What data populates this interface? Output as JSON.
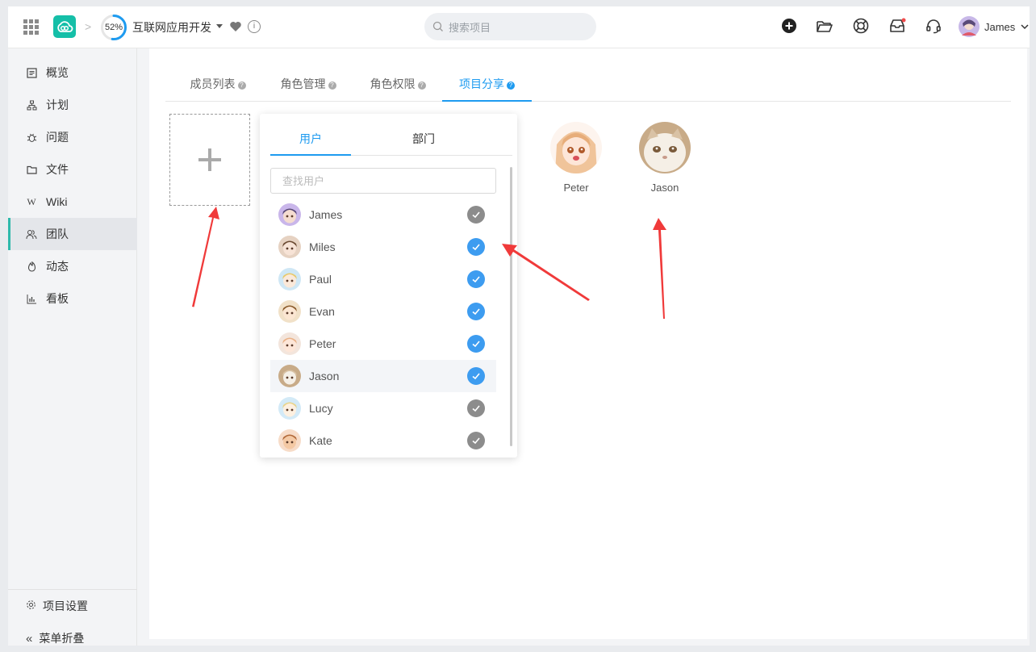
{
  "header": {
    "progress": "52%",
    "progress_value": 0.52,
    "project_name": "互联网应用开发",
    "search_placeholder": "搜索项目",
    "user_name": "James",
    "accent": "#1e9bf0",
    "brand": "#15bfa8",
    "icons": [
      "apps-grid-icon",
      "cloud-logo-icon",
      "heart-icon",
      "info-icon",
      "plus-circle-icon",
      "folder-open-icon",
      "lifebuoy-icon",
      "inbox-icon",
      "headset-icon",
      "chevron-down-icon"
    ]
  },
  "sidebar": {
    "items": [
      {
        "label": "概览",
        "icon": "overview-icon"
      },
      {
        "label": "计划",
        "icon": "plan-icon"
      },
      {
        "label": "问题",
        "icon": "bug-icon"
      },
      {
        "label": "文件",
        "icon": "folder-icon"
      },
      {
        "label": "Wiki",
        "icon": "wiki-icon"
      },
      {
        "label": "团队",
        "icon": "team-icon"
      },
      {
        "label": "动态",
        "icon": "activity-icon"
      },
      {
        "label": "看板",
        "icon": "chart-icon"
      }
    ],
    "active_index": 5,
    "settings_label": "项目设置",
    "collapse_label": "菜单折叠"
  },
  "tabs": [
    {
      "label": "成员列表"
    },
    {
      "label": "角色管理"
    },
    {
      "label": "角色权限"
    },
    {
      "label": "项目分享"
    }
  ],
  "active_tab": 3,
  "members": [
    {
      "name": "Peter"
    },
    {
      "name": "Jason"
    }
  ],
  "popover": {
    "tabs": [
      "用户",
      "部门"
    ],
    "search_placeholder": "查找用户",
    "users": [
      {
        "name": "James",
        "checked": false
      },
      {
        "name": "Miles",
        "checked": true
      },
      {
        "name": "Paul",
        "checked": true
      },
      {
        "name": "Evan",
        "checked": true
      },
      {
        "name": "Peter",
        "checked": true
      },
      {
        "name": "Jason",
        "checked": true
      },
      {
        "name": "Lucy",
        "checked": false
      },
      {
        "name": "Kate",
        "checked": false
      }
    ],
    "checked_color": "#3d9cf0",
    "unchecked_color": "#8c8c8c"
  }
}
